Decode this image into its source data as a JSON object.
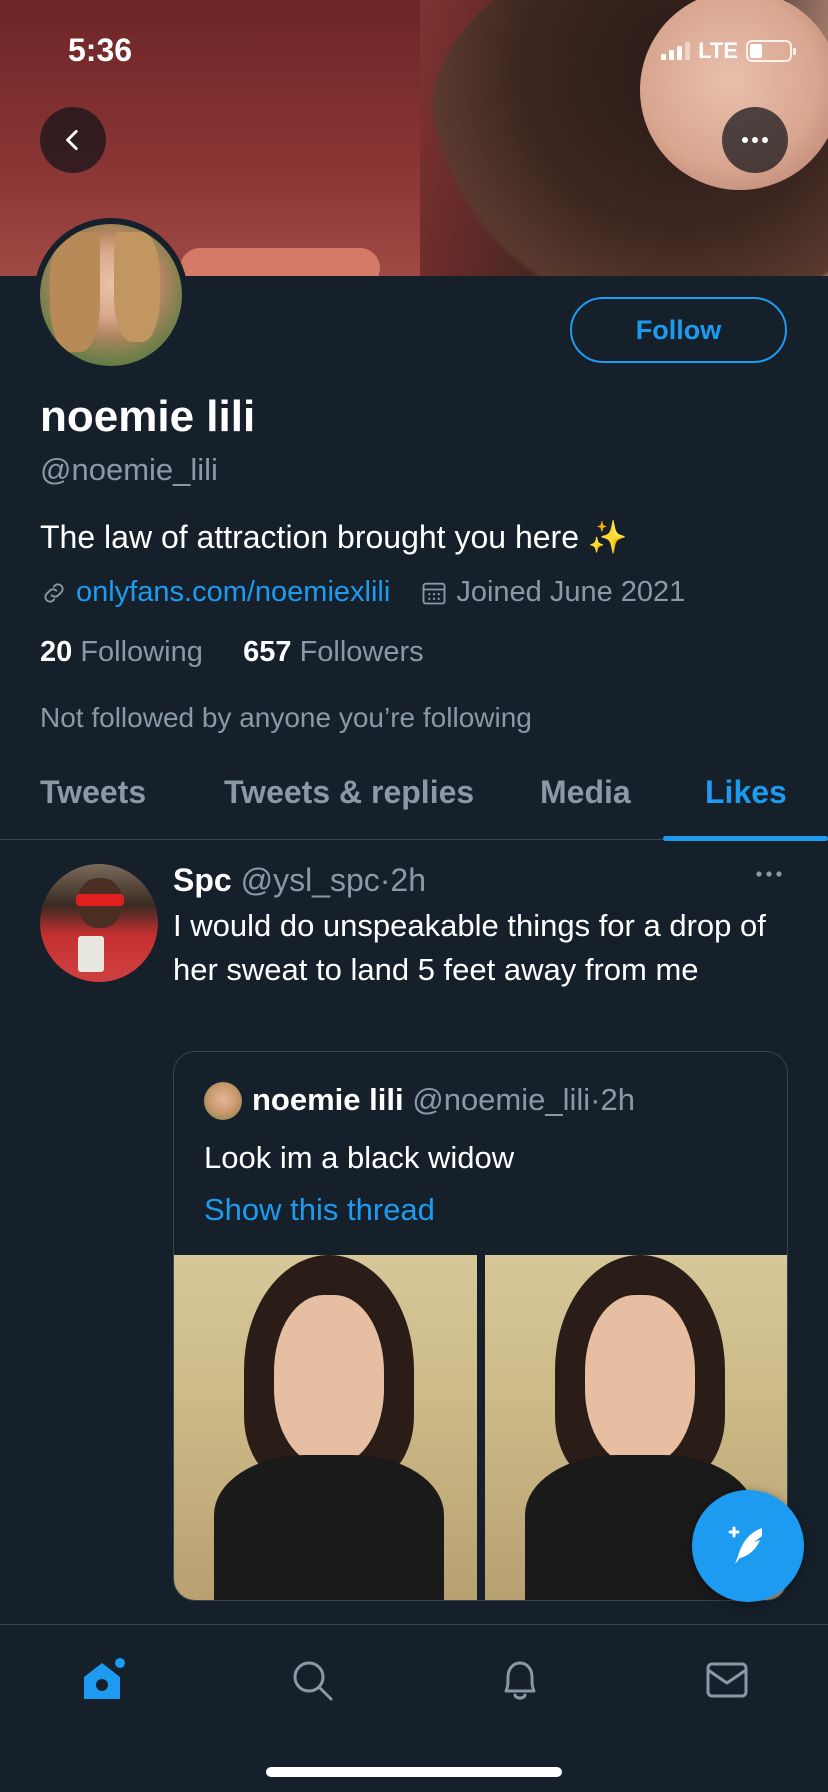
{
  "status": {
    "time": "5:36",
    "network": "LTE"
  },
  "profile": {
    "name": "noemie lili",
    "handle": "@noemie_lili",
    "bio": "The law of attraction brought you here ✨",
    "link": "onlyfans.com/noemiexlili",
    "joined": "Joined June 2021",
    "following_count": "20",
    "following_label": "Following",
    "followers_count": "657",
    "followers_label": "Followers",
    "not_followed": "Not followed by anyone you’re following",
    "follow_label": "Follow"
  },
  "tabs": [
    {
      "label": "Tweets"
    },
    {
      "label": "Tweets & replies"
    },
    {
      "label": "Media"
    },
    {
      "label": "Likes"
    }
  ],
  "tweet": {
    "display_name": "Spc",
    "username": "@ysl_spc",
    "separator": "·",
    "time": "2h",
    "text": "I would do unspeakable things for a drop of her sweat to land 5 feet away from me",
    "quote": {
      "display_name": "noemie lili",
      "username": "@noemie_lili",
      "separator": "·",
      "time": "2h",
      "text": "Look im a black widow",
      "thread_link": "Show this thread"
    }
  },
  "colors": {
    "accent": "#1d9bf0",
    "background": "#15202b",
    "secondary_text": "#8b98a5",
    "border": "#38444d"
  },
  "icons": {
    "back": "chevron-left-icon",
    "more": "more-horizontal-icon",
    "link": "link-icon",
    "calendar": "calendar-icon",
    "compose": "compose-tweet-icon",
    "nav": [
      "home-icon",
      "search-icon",
      "notifications-icon",
      "messages-icon"
    ]
  }
}
